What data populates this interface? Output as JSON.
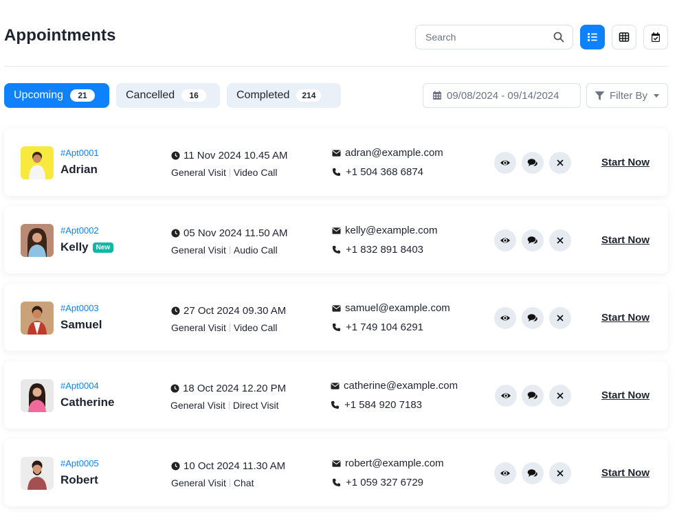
{
  "header": {
    "title": "Appointments",
    "search_placeholder": "Search",
    "views": [
      "list-view-icon",
      "grid-view-icon",
      "calendar-view-icon"
    ]
  },
  "tabs": [
    {
      "label": "Upcoming",
      "count": "21",
      "active": true
    },
    {
      "label": "Cancelled",
      "count": "16",
      "active": false
    },
    {
      "label": "Completed",
      "count": "214",
      "active": false
    }
  ],
  "filters": {
    "date_range": "09/08/2024 - 09/14/2024",
    "filter_label": "Filter By"
  },
  "appointments": [
    {
      "id": "#Apt0001",
      "name": "Adrian",
      "badge": "",
      "datetime": "11 Nov 2024 10.45 AM",
      "visit": "General Visit",
      "mode": "Video Call",
      "email": "adran@example.com",
      "phone": "+1 504 368 6874",
      "action": "Start Now"
    },
    {
      "id": "#Apt0002",
      "name": "Kelly",
      "badge": "New",
      "datetime": "05 Nov 2024 11.50 AM",
      "visit": "General Visit",
      "mode": "Audio Call",
      "email": "kelly@example.com",
      "phone": "+1 832 891 8403",
      "action": "Start Now"
    },
    {
      "id": "#Apt0003",
      "name": "Samuel",
      "badge": "",
      "datetime": "27 Oct 2024 09.30 AM",
      "visit": "General Visit",
      "mode": "Video Call",
      "email": "samuel@example.com",
      "phone": "+1 749 104 6291",
      "action": "Start Now"
    },
    {
      "id": "#Apt0004",
      "name": "Catherine",
      "badge": "",
      "datetime": "18 Oct 2024 12.20 PM",
      "visit": "General Visit",
      "mode": "Direct Visit",
      "email": "catherine@example.com",
      "phone": "+1 584 920 7183",
      "action": "Start Now"
    },
    {
      "id": "#Apt0005",
      "name": "Robert",
      "badge": "",
      "datetime": "10 Oct 2024 11.30 AM",
      "visit": "General Visit",
      "mode": "Chat",
      "email": "robert@example.com",
      "phone": "+1 059 327 6729",
      "action": "Start Now"
    }
  ],
  "colors": {
    "accent": "#0e82fd",
    "badge_new": "#0eb8a5",
    "tab_bg": "#e9f0f7",
    "action_bg": "#e5ebf1"
  },
  "icons": {
    "search": "search-icon",
    "calendar": "calendar-icon",
    "filter": "filter-icon",
    "clock": "clock-icon",
    "email": "envelope-icon",
    "phone": "phone-icon",
    "view": "eye-icon",
    "chat": "chat-icon",
    "cancel": "close-icon"
  }
}
